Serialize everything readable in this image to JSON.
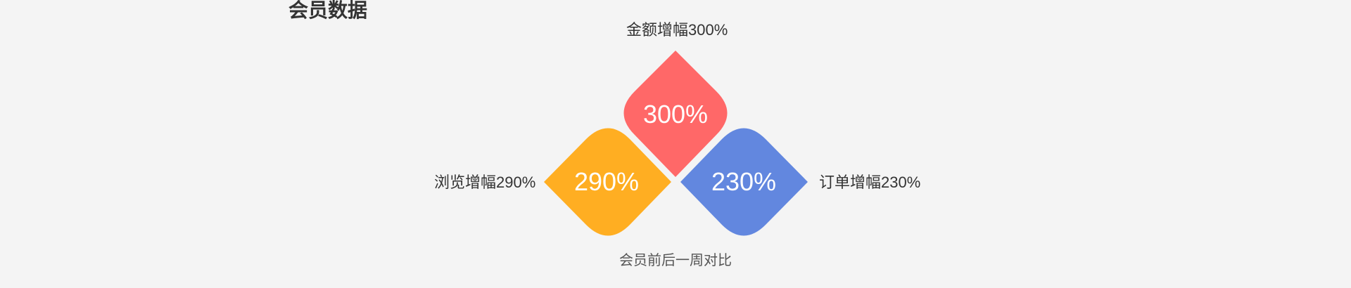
{
  "header": {
    "title": "会员数据"
  },
  "caption": "会员前后一周对比",
  "colors": {
    "amount": "#ff6868",
    "browse": "#ffae22",
    "order": "#6287df"
  },
  "chart_data": {
    "type": "other",
    "items": [
      {
        "key": "amount",
        "label": "金额增幅300%",
        "value_text": "300%",
        "value": 300
      },
      {
        "key": "browse",
        "label": "浏览增幅290%",
        "value_text": "290%",
        "value": 290
      },
      {
        "key": "order",
        "label": "订单增幅230%",
        "value_text": "230%",
        "value": 230
      }
    ]
  }
}
